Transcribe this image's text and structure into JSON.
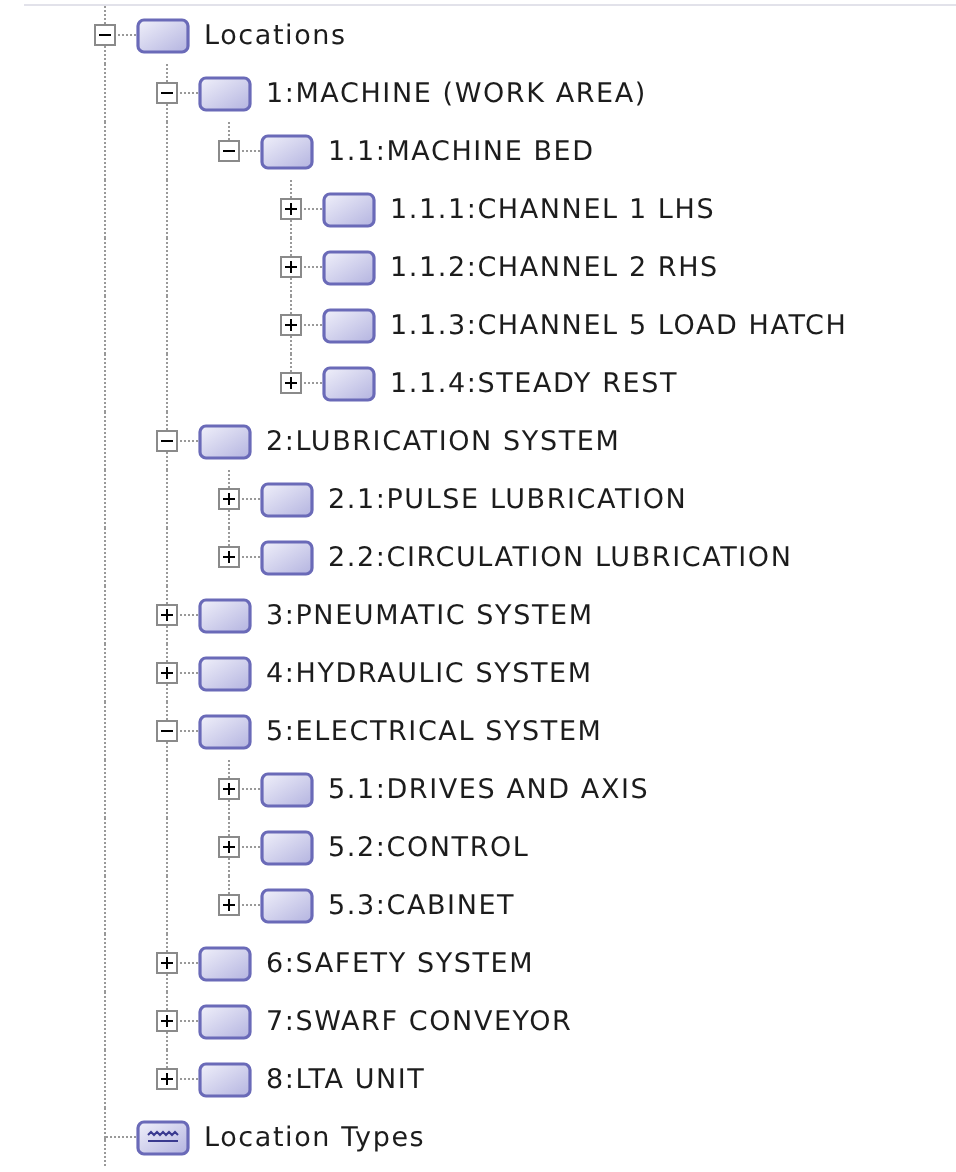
{
  "tree": {
    "continues_below": true,
    "items": [
      {
        "label": "Locations",
        "kind": "folder",
        "expanded": true,
        "children": [
          {
            "label": "1:MACHINE (WORK AREA)",
            "kind": "folder",
            "expanded": true,
            "children": [
              {
                "label": "1.1:MACHINE BED",
                "kind": "folder",
                "expanded": true,
                "children": [
                  {
                    "label": "1.1.1:CHANNEL 1 LHS",
                    "kind": "folder",
                    "expanded": false
                  },
                  {
                    "label": "1.1.2:CHANNEL 2 RHS",
                    "kind": "folder",
                    "expanded": false
                  },
                  {
                    "label": "1.1.3:CHANNEL 5 LOAD HATCH",
                    "kind": "folder",
                    "expanded": false
                  },
                  {
                    "label": "1.1.4:STEADY REST",
                    "kind": "folder",
                    "expanded": false
                  }
                ]
              }
            ]
          },
          {
            "label": "2:LUBRICATION SYSTEM",
            "kind": "folder",
            "expanded": true,
            "children": [
              {
                "label": "2.1:PULSE LUBRICATION",
                "kind": "folder",
                "expanded": false
              },
              {
                "label": "2.2:CIRCULATION LUBRICATION",
                "kind": "folder",
                "expanded": false
              }
            ]
          },
          {
            "label": "3:PNEUMATIC SYSTEM",
            "kind": "folder",
            "expanded": false
          },
          {
            "label": "4:HYDRAULIC SYSTEM",
            "kind": "folder",
            "expanded": false
          },
          {
            "label": "5:ELECTRICAL SYSTEM",
            "kind": "folder",
            "expanded": true,
            "children": [
              {
                "label": "5.1:DRIVES AND AXIS",
                "kind": "folder",
                "expanded": false
              },
              {
                "label": "5.2:CONTROL",
                "kind": "folder",
                "expanded": false
              },
              {
                "label": "5.3:CABINET",
                "kind": "folder",
                "expanded": false
              }
            ]
          },
          {
            "label": "6:SAFETY SYSTEM",
            "kind": "folder",
            "expanded": false
          },
          {
            "label": "7:SWARF CONVEYOR",
            "kind": "folder",
            "expanded": false
          },
          {
            "label": "8:LTA UNIT",
            "kind": "folder",
            "expanded": false
          }
        ]
      },
      {
        "label": "Location Types",
        "kind": "type-list"
      }
    ]
  }
}
